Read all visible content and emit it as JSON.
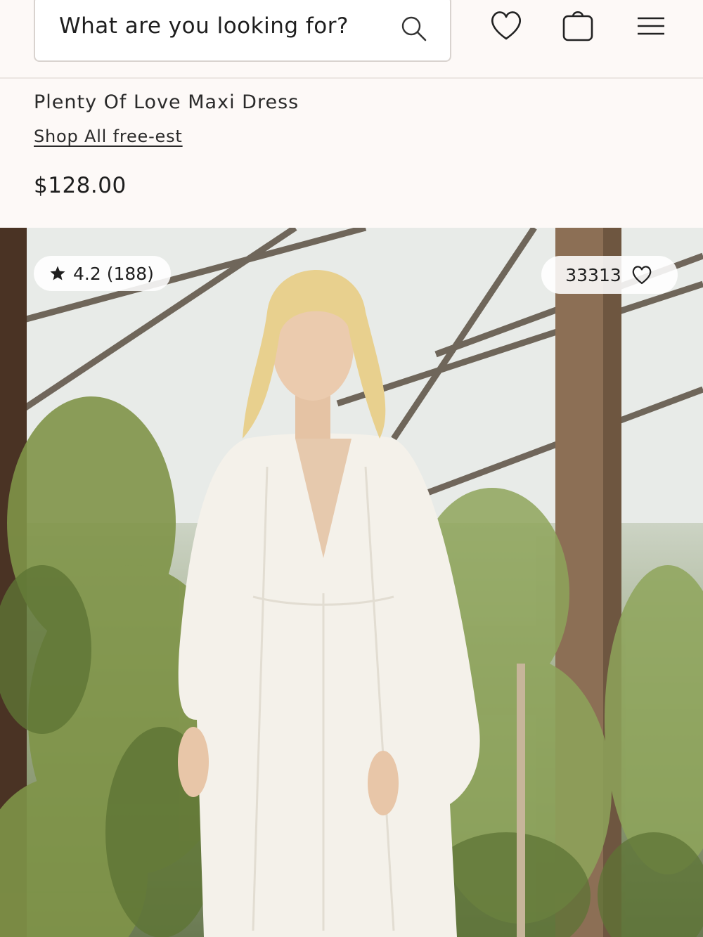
{
  "header": {
    "search": {
      "placeholder": "What are you looking for?"
    },
    "icons": [
      "search-icon",
      "heart-icon",
      "bag-icon",
      "menu-icon"
    ]
  },
  "product": {
    "title": "Plenty Of Love Maxi Dress",
    "shop_link": "Shop All free-est",
    "price": "$128.00"
  },
  "image": {
    "rating": "4.2 (188)",
    "favorites_count": "33313"
  },
  "colors": {
    "page_background": "#fdf9f7",
    "text": "#222222",
    "border": "#d9d3cf"
  }
}
